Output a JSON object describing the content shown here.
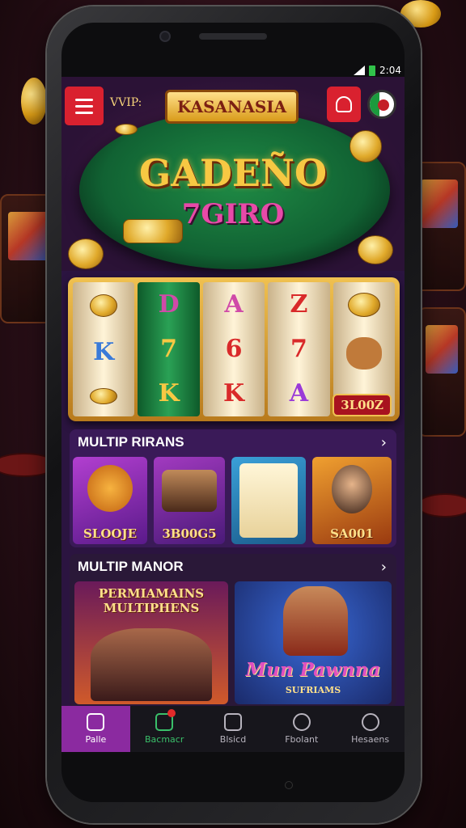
{
  "status_bar": {
    "time": "2:04"
  },
  "header": {
    "menu_icon": "hamburger-icon",
    "vip_label": "VVIP:",
    "brand": "KASANASIA",
    "promo_icon": "gift-icon",
    "flag_icon": "language-flag-icon"
  },
  "hero": {
    "title_line1": "GADEÑO",
    "title_line2": "7GIRO"
  },
  "slot": {
    "reels": [
      [
        "",
        "K",
        ""
      ],
      [
        "D",
        "7",
        "K"
      ],
      [
        "A",
        "6",
        "K"
      ],
      [
        "Z",
        "7",
        "A"
      ],
      [
        "",
        "",
        ""
      ]
    ],
    "win_amount": "3L00Z"
  },
  "section1": {
    "title": "MULTIP RIRANS",
    "tiles": [
      {
        "label": "SLOOJE"
      },
      {
        "label": "3B00G5"
      },
      {
        "label": ""
      },
      {
        "label": "SA001"
      }
    ]
  },
  "section2": {
    "title": "MULTIP MANOR",
    "tiles": [
      {
        "headline": "PERMIAMAINS MULTIPHENS"
      },
      {
        "headline": "Mun Pawnna",
        "sub": "SUFRIAMS"
      }
    ]
  },
  "nav": {
    "items": [
      {
        "label": "Palle",
        "icon": "home-icon",
        "active": true
      },
      {
        "label": "Bacmacr",
        "icon": "chart-icon",
        "badge": true
      },
      {
        "label": "Blsicd",
        "icon": "card-icon"
      },
      {
        "label": "Fbolant",
        "icon": "search-icon"
      },
      {
        "label": "Hesaens",
        "icon": "user-icon"
      }
    ]
  },
  "colors": {
    "accent": "#8b2aa0",
    "red": "#d9212f",
    "gold": "#f0c150"
  }
}
